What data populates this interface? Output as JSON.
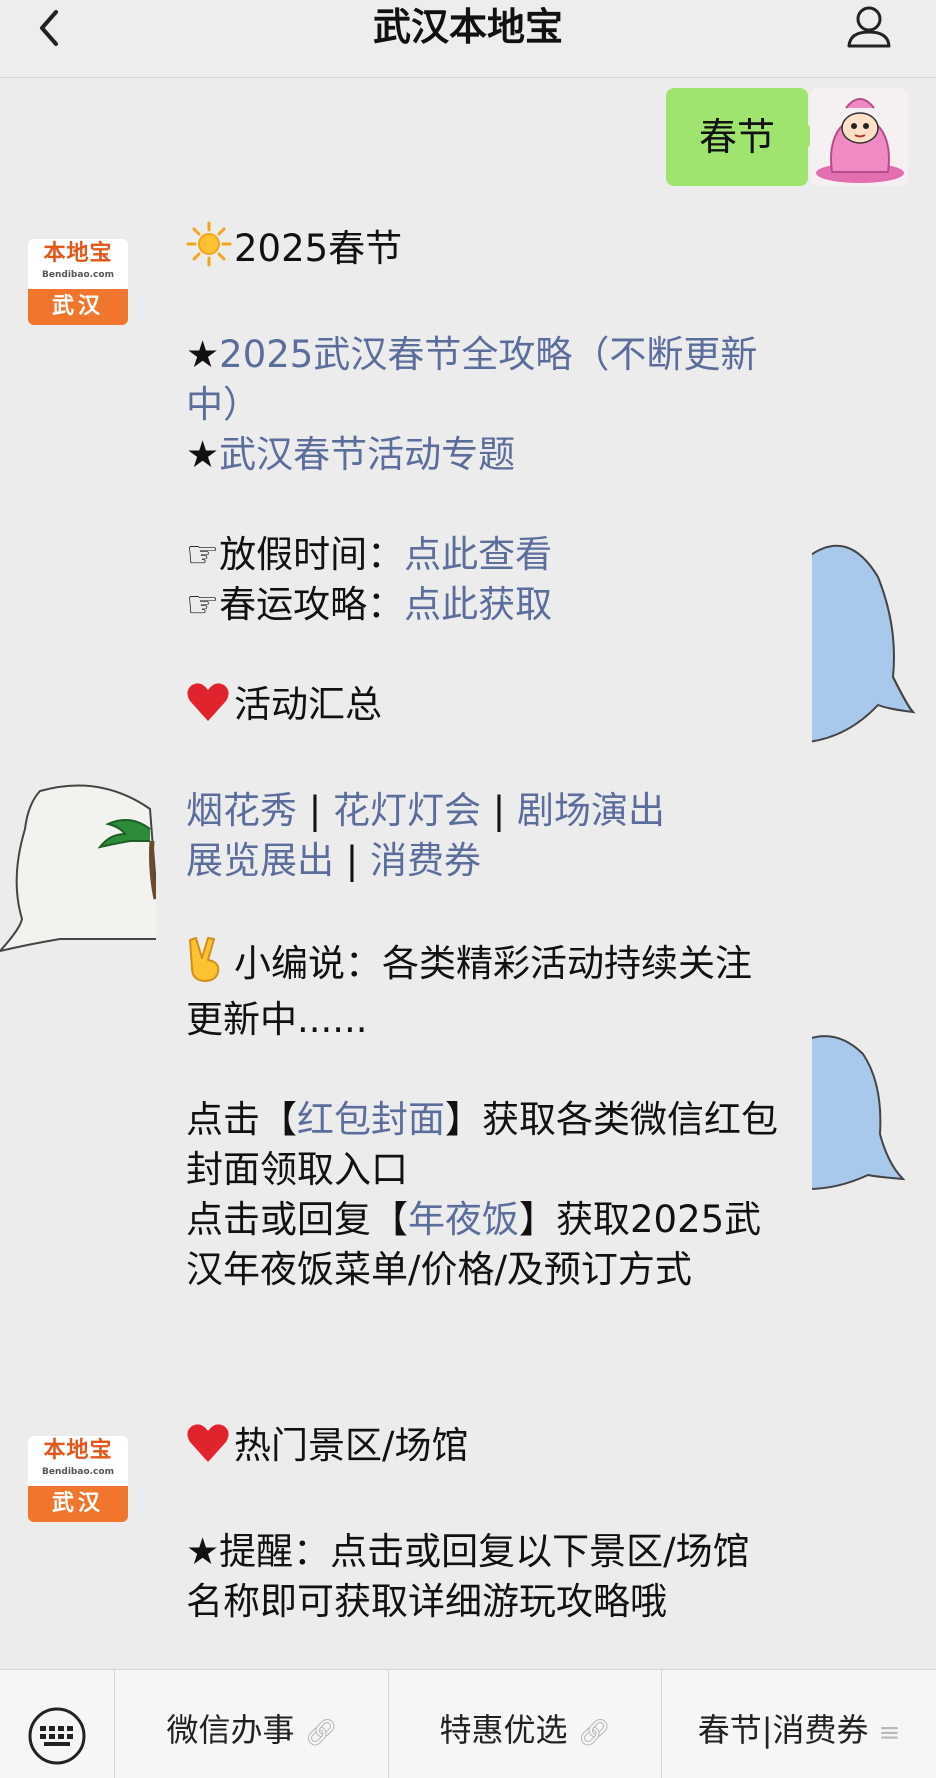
{
  "header": {
    "title": "武汉本地宝"
  },
  "my_message": {
    "text": "春节"
  },
  "bot_avatar": {
    "logo_text": "本地宝",
    "logo_sub": "Bendibao.com",
    "city": "武汉"
  },
  "message1": {
    "heading_icon": "sun-emoji",
    "heading": "2025春节",
    "guide_star": "★",
    "guide_link": "2025武汉春节全攻略（不断更新中）",
    "topic_star": "★",
    "topic_link": "武汉春节活动专题",
    "holiday_label": "☞放假时间：",
    "holiday_link": "点此查看",
    "travel_label": "☞春运攻略：",
    "travel_link": "点此获取",
    "summary_icon": "heart-emoji",
    "summary_heading": "活动汇总",
    "activities": [
      "烟花秀",
      "花灯灯会",
      "剧场演出",
      "展览展出",
      "消费券"
    ],
    "separator": " | ",
    "editor_icon": "victory-hand-emoji",
    "editor_note": "小编说：各类精彩活动持续关注更新中......",
    "cover_prefix": "点击【",
    "cover_link": "红包封面",
    "cover_suffix": "】获取各类微信红包封面领取入口",
    "dinner_prefix": "点击或回复【",
    "dinner_link": "年夜饭",
    "dinner_suffix": "】获取2025武汉年夜饭菜单/价格/及预订方式"
  },
  "message2": {
    "heading_icon": "heart-emoji",
    "heading": "热门景区/场馆",
    "reminder": "★提醒：点击或回复以下景区/场馆名称即可获取详细游玩攻略哦"
  },
  "bottom_menu": {
    "items": [
      {
        "label": "微信办事",
        "icon": "link-icon"
      },
      {
        "label": "特惠优选",
        "icon": "link-icon"
      },
      {
        "label": "春节|消费券",
        "icon": "menu-lines-icon"
      }
    ]
  },
  "colors": {
    "link": "#5a6d9b",
    "my_bubble": "#9ee46f",
    "avatar_orange": "#f0762d"
  }
}
